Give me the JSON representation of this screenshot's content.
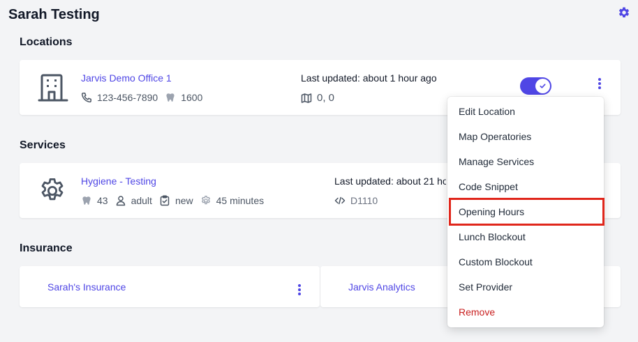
{
  "page": {
    "title": "Sarah Testing"
  },
  "locations": {
    "heading": "Locations",
    "card": {
      "name": "Jarvis Demo Office 1",
      "phone": "123-456-7890",
      "tooth_count": "1600",
      "last_updated": "Last updated: about 1 hour ago",
      "coordinates": "0, 0",
      "enabled": true
    }
  },
  "services": {
    "heading": "Services",
    "card": {
      "name": "Hygiene - Testing",
      "tooth_count": "43",
      "age_group": "adult",
      "patient_type": "new",
      "duration": "45 minutes",
      "last_updated": "Last updated: about 21 ho",
      "code": "D1110"
    }
  },
  "insurance": {
    "heading": "Insurance",
    "cards": [
      {
        "name": "Sarah's Insurance"
      },
      {
        "name": "Jarvis Analytics"
      }
    ]
  },
  "menu": {
    "items": [
      {
        "label": "Edit Location"
      },
      {
        "label": "Map Operatories"
      },
      {
        "label": "Manage Services"
      },
      {
        "label": "Code Snippet"
      },
      {
        "label": "Opening Hours"
      },
      {
        "label": "Lunch Blockout"
      },
      {
        "label": "Custom Blockout"
      },
      {
        "label": "Set Provider"
      },
      {
        "label": "Remove"
      }
    ]
  },
  "colors": {
    "accent": "#4f46e5",
    "danger": "#c81e1e",
    "highlight": "#e0261b"
  }
}
